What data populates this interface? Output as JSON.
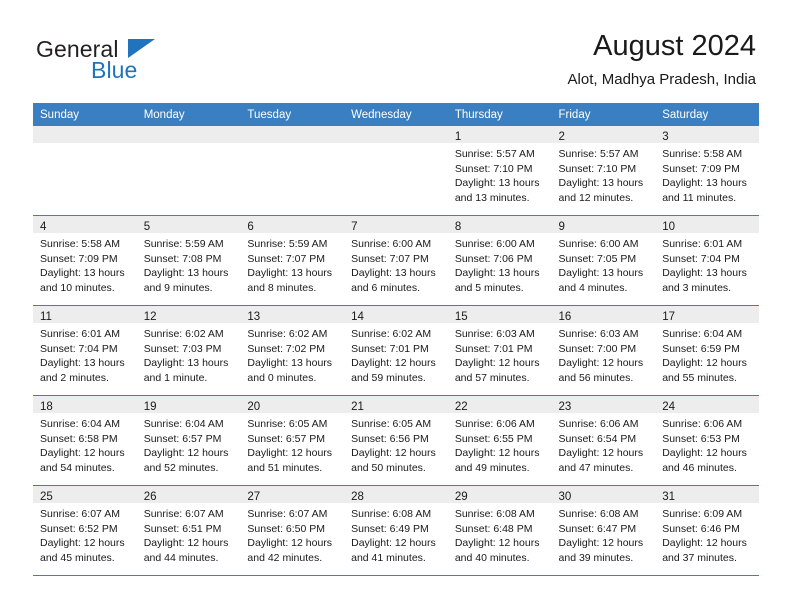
{
  "brand": {
    "word1": "General",
    "word2": "Blue",
    "logo_icon": "triangle-icon",
    "accent_color": "#1f74bd"
  },
  "header": {
    "title": "August 2024",
    "subtitle": "Alot, Madhya Pradesh, India"
  },
  "theme": {
    "header_bg": "#3a7fc1",
    "daynum_bg": "#ededed",
    "row_divider": "#3a7fc1",
    "text": "#1a1a1a"
  },
  "weekday_headers": [
    "Sunday",
    "Monday",
    "Tuesday",
    "Wednesday",
    "Thursday",
    "Friday",
    "Saturday"
  ],
  "weeks": [
    [
      {
        "day": "",
        "lines": []
      },
      {
        "day": "",
        "lines": []
      },
      {
        "day": "",
        "lines": []
      },
      {
        "day": "",
        "lines": []
      },
      {
        "day": "1",
        "lines": [
          "Sunrise: 5:57 AM",
          "Sunset: 7:10 PM",
          "Daylight: 13 hours",
          "and 13 minutes."
        ]
      },
      {
        "day": "2",
        "lines": [
          "Sunrise: 5:57 AM",
          "Sunset: 7:10 PM",
          "Daylight: 13 hours",
          "and 12 minutes."
        ]
      },
      {
        "day": "3",
        "lines": [
          "Sunrise: 5:58 AM",
          "Sunset: 7:09 PM",
          "Daylight: 13 hours",
          "and 11 minutes."
        ]
      }
    ],
    [
      {
        "day": "4",
        "lines": [
          "Sunrise: 5:58 AM",
          "Sunset: 7:09 PM",
          "Daylight: 13 hours",
          "and 10 minutes."
        ]
      },
      {
        "day": "5",
        "lines": [
          "Sunrise: 5:59 AM",
          "Sunset: 7:08 PM",
          "Daylight: 13 hours",
          "and 9 minutes."
        ]
      },
      {
        "day": "6",
        "lines": [
          "Sunrise: 5:59 AM",
          "Sunset: 7:07 PM",
          "Daylight: 13 hours",
          "and 8 minutes."
        ]
      },
      {
        "day": "7",
        "lines": [
          "Sunrise: 6:00 AM",
          "Sunset: 7:07 PM",
          "Daylight: 13 hours",
          "and 6 minutes."
        ]
      },
      {
        "day": "8",
        "lines": [
          "Sunrise: 6:00 AM",
          "Sunset: 7:06 PM",
          "Daylight: 13 hours",
          "and 5 minutes."
        ]
      },
      {
        "day": "9",
        "lines": [
          "Sunrise: 6:00 AM",
          "Sunset: 7:05 PM",
          "Daylight: 13 hours",
          "and 4 minutes."
        ]
      },
      {
        "day": "10",
        "lines": [
          "Sunrise: 6:01 AM",
          "Sunset: 7:04 PM",
          "Daylight: 13 hours",
          "and 3 minutes."
        ]
      }
    ],
    [
      {
        "day": "11",
        "lines": [
          "Sunrise: 6:01 AM",
          "Sunset: 7:04 PM",
          "Daylight: 13 hours",
          "and 2 minutes."
        ]
      },
      {
        "day": "12",
        "lines": [
          "Sunrise: 6:02 AM",
          "Sunset: 7:03 PM",
          "Daylight: 13 hours",
          "and 1 minute."
        ]
      },
      {
        "day": "13",
        "lines": [
          "Sunrise: 6:02 AM",
          "Sunset: 7:02 PM",
          "Daylight: 13 hours",
          "and 0 minutes."
        ]
      },
      {
        "day": "14",
        "lines": [
          "Sunrise: 6:02 AM",
          "Sunset: 7:01 PM",
          "Daylight: 12 hours",
          "and 59 minutes."
        ]
      },
      {
        "day": "15",
        "lines": [
          "Sunrise: 6:03 AM",
          "Sunset: 7:01 PM",
          "Daylight: 12 hours",
          "and 57 minutes."
        ]
      },
      {
        "day": "16",
        "lines": [
          "Sunrise: 6:03 AM",
          "Sunset: 7:00 PM",
          "Daylight: 12 hours",
          "and 56 minutes."
        ]
      },
      {
        "day": "17",
        "lines": [
          "Sunrise: 6:04 AM",
          "Sunset: 6:59 PM",
          "Daylight: 12 hours",
          "and 55 minutes."
        ]
      }
    ],
    [
      {
        "day": "18",
        "lines": [
          "Sunrise: 6:04 AM",
          "Sunset: 6:58 PM",
          "Daylight: 12 hours",
          "and 54 minutes."
        ]
      },
      {
        "day": "19",
        "lines": [
          "Sunrise: 6:04 AM",
          "Sunset: 6:57 PM",
          "Daylight: 12 hours",
          "and 52 minutes."
        ]
      },
      {
        "day": "20",
        "lines": [
          "Sunrise: 6:05 AM",
          "Sunset: 6:57 PM",
          "Daylight: 12 hours",
          "and 51 minutes."
        ]
      },
      {
        "day": "21",
        "lines": [
          "Sunrise: 6:05 AM",
          "Sunset: 6:56 PM",
          "Daylight: 12 hours",
          "and 50 minutes."
        ]
      },
      {
        "day": "22",
        "lines": [
          "Sunrise: 6:06 AM",
          "Sunset: 6:55 PM",
          "Daylight: 12 hours",
          "and 49 minutes."
        ]
      },
      {
        "day": "23",
        "lines": [
          "Sunrise: 6:06 AM",
          "Sunset: 6:54 PM",
          "Daylight: 12 hours",
          "and 47 minutes."
        ]
      },
      {
        "day": "24",
        "lines": [
          "Sunrise: 6:06 AM",
          "Sunset: 6:53 PM",
          "Daylight: 12 hours",
          "and 46 minutes."
        ]
      }
    ],
    [
      {
        "day": "25",
        "lines": [
          "Sunrise: 6:07 AM",
          "Sunset: 6:52 PM",
          "Daylight: 12 hours",
          "and 45 minutes."
        ]
      },
      {
        "day": "26",
        "lines": [
          "Sunrise: 6:07 AM",
          "Sunset: 6:51 PM",
          "Daylight: 12 hours",
          "and 44 minutes."
        ]
      },
      {
        "day": "27",
        "lines": [
          "Sunrise: 6:07 AM",
          "Sunset: 6:50 PM",
          "Daylight: 12 hours",
          "and 42 minutes."
        ]
      },
      {
        "day": "28",
        "lines": [
          "Sunrise: 6:08 AM",
          "Sunset: 6:49 PM",
          "Daylight: 12 hours",
          "and 41 minutes."
        ]
      },
      {
        "day": "29",
        "lines": [
          "Sunrise: 6:08 AM",
          "Sunset: 6:48 PM",
          "Daylight: 12 hours",
          "and 40 minutes."
        ]
      },
      {
        "day": "30",
        "lines": [
          "Sunrise: 6:08 AM",
          "Sunset: 6:47 PM",
          "Daylight: 12 hours",
          "and 39 minutes."
        ]
      },
      {
        "day": "31",
        "lines": [
          "Sunrise: 6:09 AM",
          "Sunset: 6:46 PM",
          "Daylight: 12 hours",
          "and 37 minutes."
        ]
      }
    ]
  ]
}
